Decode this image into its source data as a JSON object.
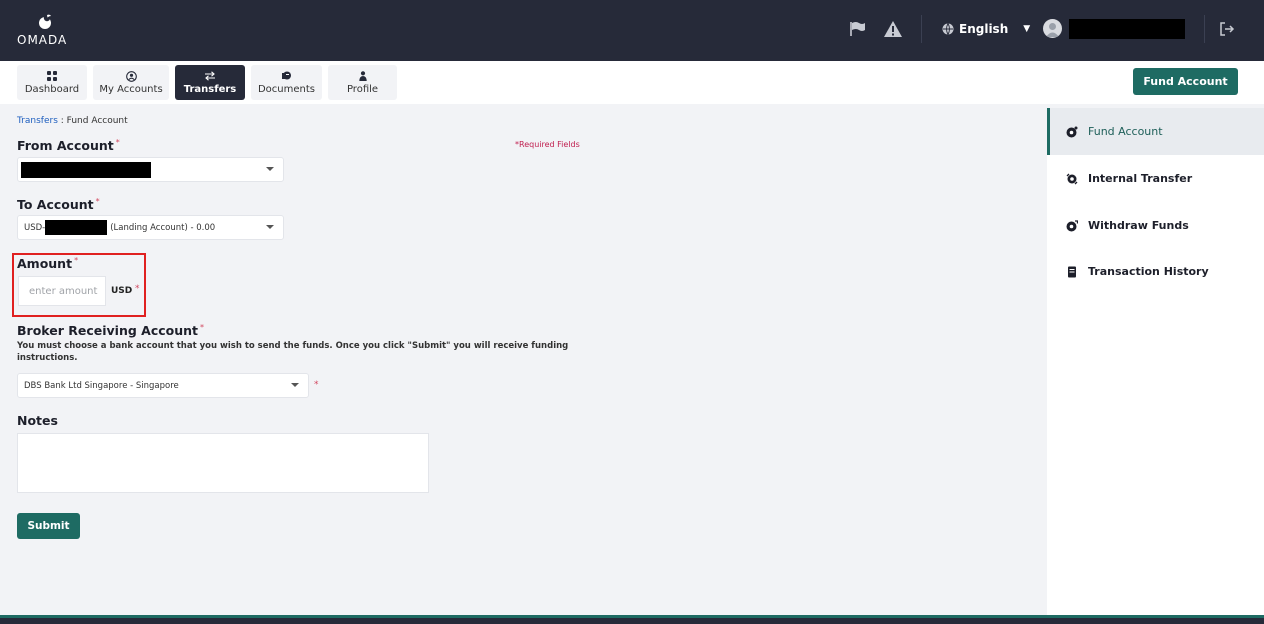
{
  "brand": {
    "name": "OMADA"
  },
  "header": {
    "language": "English",
    "icons": [
      "flag-icon",
      "warning-icon",
      "globe-icon",
      "user-avatar-icon",
      "logout-icon"
    ]
  },
  "nav": {
    "items": [
      {
        "label": "Dashboard",
        "icon": "grid-icon"
      },
      {
        "label": "My Accounts",
        "icon": "user-circle-icon"
      },
      {
        "label": "Transfers",
        "icon": "transfer-arrows-icon",
        "active": true
      },
      {
        "label": "Documents",
        "icon": "documents-icon"
      },
      {
        "label": "Profile",
        "icon": "person-icon"
      }
    ],
    "fund_account_button": "Fund Account"
  },
  "breadcrumb": {
    "link": "Transfers",
    "separator": " : ",
    "current": "Fund Account"
  },
  "form": {
    "required_note": "*Required Fields",
    "from_account": {
      "label": "From Account",
      "value": ""
    },
    "to_account": {
      "label": "To Account",
      "prefix": "USD-",
      "suffix": "(Landing Account) - 0.00"
    },
    "amount": {
      "label": "Amount",
      "placeholder": "enter amount",
      "currency": "USD"
    },
    "broker": {
      "label": "Broker Receiving Account",
      "helper": "You must choose a bank account that you wish to send the funds. Once you click \"Submit\" you will receive funding instructions.",
      "value": "DBS Bank Ltd Singapore - Singapore"
    },
    "notes": {
      "label": "Notes"
    },
    "submit_label": "Submit"
  },
  "sidebar": {
    "items": [
      {
        "label": "Fund Account",
        "icon": "fund-icon",
        "active": true
      },
      {
        "label": "Internal Transfer",
        "icon": "internal-transfer-icon"
      },
      {
        "label": "Withdraw Funds",
        "icon": "withdraw-icon"
      },
      {
        "label": "Transaction History",
        "icon": "history-icon"
      }
    ]
  },
  "colors": {
    "header_bg": "#262a39",
    "accent": "#1e6b63",
    "required": "#d2475f",
    "highlight": "#e02020",
    "link": "#1f5fbf"
  }
}
